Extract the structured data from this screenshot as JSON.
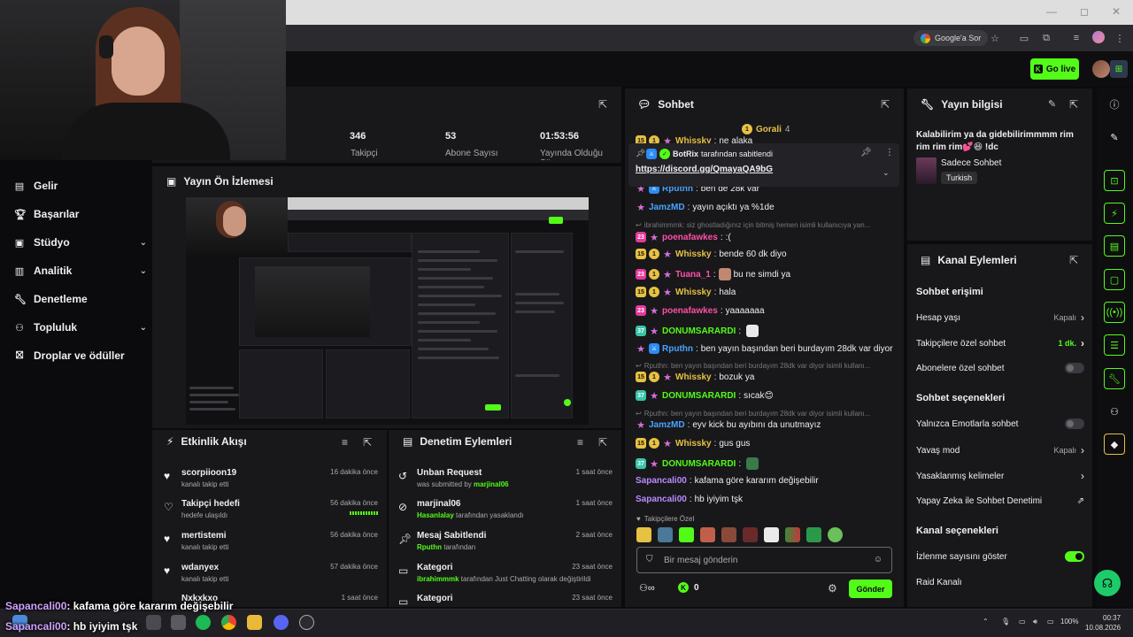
{
  "browser": {
    "google_ask_label": "Google'a Sor"
  },
  "header": {
    "go_live_label": "Go live"
  },
  "sidebar": {
    "items": [
      {
        "label": "Gelir",
        "icon": "wallet-icon"
      },
      {
        "label": "Başarılar",
        "icon": "trophy-icon"
      },
      {
        "label": "Stüdyo",
        "icon": "studio-icon"
      },
      {
        "label": "Analitik",
        "icon": "analytics-icon"
      },
      {
        "label": "Denetleme",
        "icon": "wrench-icon"
      },
      {
        "label": "Topluluk",
        "icon": "community-icon"
      },
      {
        "label": "Droplar ve ödüller",
        "icon": "gift-icon"
      }
    ]
  },
  "stats": [
    {
      "value": "346",
      "label": "Takipçi"
    },
    {
      "value": "53",
      "label": "Abone Sayısı"
    },
    {
      "value": "01:53:56",
      "label": "Yayında Olduğu Süre"
    }
  ],
  "preview": {
    "title": "Yayın Ön İzlemesi"
  },
  "activity": {
    "title": "Etkinlik Akışı",
    "items": [
      {
        "name": "scorpiioon19",
        "sub": "kanalı takip etti",
        "time": "16 dakika önce",
        "icon": "heart"
      },
      {
        "name": "Takipçi hedefi",
        "sub": "hedefe ulaşıldı",
        "time": "56 dakika önce",
        "icon": "heart-outline"
      },
      {
        "name": "mertistemi",
        "sub": "kanalı takip etti",
        "time": "56 dakika önce",
        "icon": "heart"
      },
      {
        "name": "wdanyex",
        "sub": "kanalı takip etti",
        "time": "57 dakika önce",
        "icon": "heart"
      },
      {
        "name": "Nxkxkxo",
        "sub": "",
        "time": "1 saat önce",
        "icon": "heart"
      }
    ]
  },
  "moderation": {
    "title": "Denetim Eylemleri",
    "items": [
      {
        "name": "Unban Request",
        "pre": "was submitted by ",
        "hl": "marjinal06",
        "post": "",
        "time": "1 saat önce",
        "icon": "undo"
      },
      {
        "name": "marjinal06",
        "pre": "",
        "hl": "Hasanlalay",
        "post": " tarafından yasaklandı",
        "time": "1 saat önce",
        "icon": "ban"
      },
      {
        "name": "Mesaj Sabitlendi",
        "pre": "",
        "hl": "Rputhn",
        "post": " tarafından",
        "time": "2 saat önce",
        "icon": "pin"
      },
      {
        "name": "Kategori",
        "pre": "",
        "hl": "ibrahimmmk",
        "post": " tarafından Just Chatting olarak değiştirildi",
        "time": "23 saat önce",
        "icon": "category"
      },
      {
        "name": "Kategori",
        "pre": "",
        "hl": "",
        "post": "",
        "time": "23 saat önce",
        "icon": "category"
      }
    ]
  },
  "chat": {
    "title": "Sohbet",
    "top_gifter": "Gorali",
    "top_gifter_count": "4",
    "pinned_user": "BotRix",
    "pinned_suffix": "tarafından sabitlendi",
    "pinned_link": "https://discord.gg/QmayaQA9bG",
    "messages": [
      {
        "user": "Whissky",
        "color": "#e7c142",
        "text": "ne alaka",
        "badges": [
          "sub",
          "gift",
          "star"
        ],
        "sys": false
      },
      {
        "user": "Rputhn",
        "color": "#4aa3ff",
        "text": "ben de 28k var",
        "badges": [
          "star",
          "mod"
        ],
        "sys": false
      },
      {
        "user": "JamzMD",
        "color": "#4aa3ff",
        "text": "yayın açıktı ya %1de",
        "badges": [
          "star"
        ],
        "sys": false
      },
      {
        "user": "",
        "color": "#77777c",
        "text": "ibrahimmmk: siz ghostladığınız için bitmiş hemen isimli kullanıcıya yan...",
        "badges": [],
        "sys": true
      },
      {
        "user": "poenafawkes",
        "color": "#ff4fa5",
        "text": ":(",
        "badges": [
          "pink",
          "star"
        ],
        "sys": false
      },
      {
        "user": "Whissky",
        "color": "#e7c142",
        "text": "bende 60 dk diyo",
        "badges": [
          "sub",
          "gift",
          "star"
        ],
        "sys": false
      },
      {
        "user": "Tuana_1",
        "color": "#ff4fa5",
        "text": "bu ne simdi ya",
        "badges": [
          "pink",
          "gift",
          "star"
        ],
        "sys": false
      },
      {
        "user": "Whissky",
        "color": "#e7c142",
        "text": "hala",
        "badges": [
          "sub",
          "gift",
          "star"
        ],
        "sys": false
      },
      {
        "user": "poenafawkes",
        "color": "#ff4fa5",
        "text": "yaaaaaaa",
        "badges": [
          "pink",
          "star"
        ],
        "sys": false
      },
      {
        "user": "DONUMSARARDI",
        "color": "#53fc18",
        "text": "",
        "badges": [
          "teal",
          "star"
        ],
        "sys": false
      },
      {
        "user": "Rputhn",
        "color": "#4aa3ff",
        "text": "ben yayın başından beri burdayım 28dk var diyor",
        "badges": [
          "star",
          "mod"
        ],
        "sys": false
      },
      {
        "user": "",
        "color": "#77777c",
        "text": "Rputhn: ben yayın başından beri burdayım 28dk var diyor isimli kullanı...",
        "badges": [],
        "sys": true
      },
      {
        "user": "Whissky",
        "color": "#e7c142",
        "text": "bozuk ya",
        "badges": [
          "sub",
          "gift",
          "star"
        ],
        "sys": false
      },
      {
        "user": "DONUMSARARDI",
        "color": "#53fc18",
        "text": "sıcak😊",
        "badges": [
          "teal",
          "star"
        ],
        "sys": false
      },
      {
        "user": "",
        "color": "#77777c",
        "text": "Rputhn: ben yayın başından beri burdayım 28dk var diyor isimli kullanı...",
        "badges": [],
        "sys": true
      },
      {
        "user": "JamzMD",
        "color": "#4aa3ff",
        "text": "eyv kick bu ayıbını da unutmayız",
        "badges": [
          "star"
        ],
        "sys": false
      },
      {
        "user": "Whissky",
        "color": "#e7c142",
        "text": "gus gus",
        "badges": [
          "sub",
          "gift",
          "star"
        ],
        "sys": false
      },
      {
        "user": "DONUMSARARDI",
        "color": "#53fc18",
        "text": "",
        "badges": [
          "teal",
          "star"
        ],
        "sys": false
      },
      {
        "user": "Sapancali00",
        "color": "#b98aff",
        "text": "kafama göre kararım değişebilir",
        "badges": [],
        "sys": false
      },
      {
        "user": "Sapancali00",
        "color": "#b98aff",
        "text": "hb iyiyim tşk",
        "badges": [],
        "sys": false
      }
    ],
    "followers_only_label": "Takipçilere Özel",
    "input_placeholder": "Bir mesaj gönderin",
    "points": "0",
    "send_label": "Gönder"
  },
  "stream_info": {
    "title": "Yayın bilgisi",
    "text": "Kalabilirim ya da gidebilirimmmm rim rim rim rim💕😆 !dc",
    "category": "Sadece Sohbet",
    "tag": "Turkish"
  },
  "channel_actions": {
    "title": "Kanal Eylemleri",
    "chat_access": "Sohbet erişimi",
    "rows_access": [
      {
        "label": "Hesap yaşı",
        "value": "Kapalı",
        "type": "chevron"
      },
      {
        "label": "Takipçilere özel sohbet",
        "value": "1 dk.",
        "type": "chevron-green"
      },
      {
        "label": "Abonelere özel sohbet",
        "value": "",
        "type": "toggle-off"
      }
    ],
    "chat_options": "Sohbet seçenekleri",
    "rows_options": [
      {
        "label": "Yalnızca Emotlarla sohbet",
        "value": "",
        "type": "toggle-off"
      },
      {
        "label": "Yavaş mod",
        "value": "Kapalı",
        "type": "chevron"
      },
      {
        "label": "Yasaklanmış kelimeler",
        "value": "",
        "type": "chevron"
      },
      {
        "label": "Yapay Zeka ile Sohbet Denetimi",
        "value": "",
        "type": "external"
      }
    ],
    "channel_options": "Kanal seçenekleri",
    "rows_channel": [
      {
        "label": "İzlenme sayısını göster",
        "value": "",
        "type": "toggle-on"
      },
      {
        "label": "Raid Kanalı",
        "value": "",
        "type": "none"
      }
    ]
  },
  "overlay": {
    "lines": [
      {
        "user": "Sapancali00",
        "text": ": kafama göre kararım değişebilir"
      },
      {
        "user": "Sapancali00",
        "text": ": hb iyiyim tşk"
      }
    ]
  },
  "taskbar": {
    "battery": "100%",
    "time": "00:37",
    "date": "10.08.2026"
  }
}
